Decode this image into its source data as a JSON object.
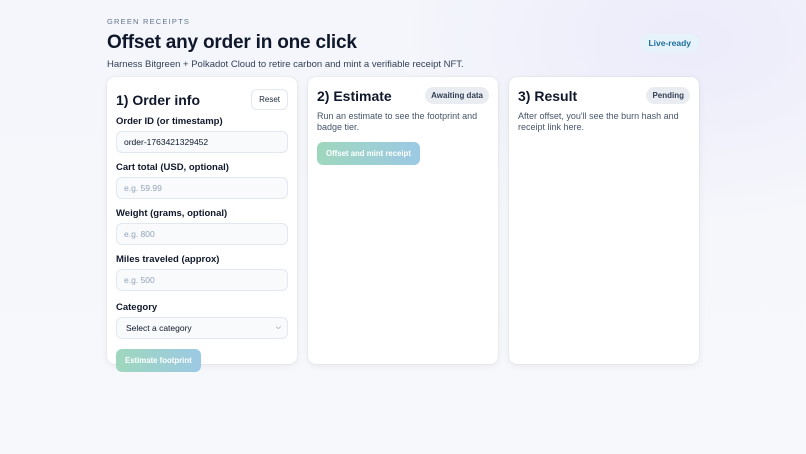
{
  "header": {
    "eyebrow": "GREEN RECEIPTS",
    "title": "Offset any order in one click",
    "subtitle": "Harness Bitgreen + Polkadot Cloud to retire carbon and mint a verifiable receipt NFT.",
    "badge": "Live-ready"
  },
  "order_card": {
    "title": "1) Order info",
    "reset_label": "Reset",
    "order_id": {
      "label": "Order ID (or timestamp)",
      "value": "order-1763421329452"
    },
    "cart_total": {
      "label": "Cart total (USD, optional)",
      "placeholder": "e.g. 59.99"
    },
    "weight": {
      "label": "Weight (grams, optional)",
      "placeholder": "e.g. 800"
    },
    "miles": {
      "label": "Miles traveled (approx)",
      "placeholder": "e.g. 500"
    },
    "category": {
      "label": "Category",
      "selected": "Select a category"
    },
    "estimate_label": "Estimate footprint"
  },
  "estimate_card": {
    "title": "2) Estimate",
    "status": "Awaiting data",
    "description": "Run an estimate to see the footprint and badge tier.",
    "offset_label": "Offset and mint receipt"
  },
  "result_card": {
    "title": "3) Result",
    "status": "Pending",
    "description": "After offset, you'll see the burn hash and receipt link here."
  },
  "colors": {
    "accent_green": "#9ed7bd",
    "accent_blue": "#9cc9e4",
    "badge_text": "#1f6f9f"
  }
}
